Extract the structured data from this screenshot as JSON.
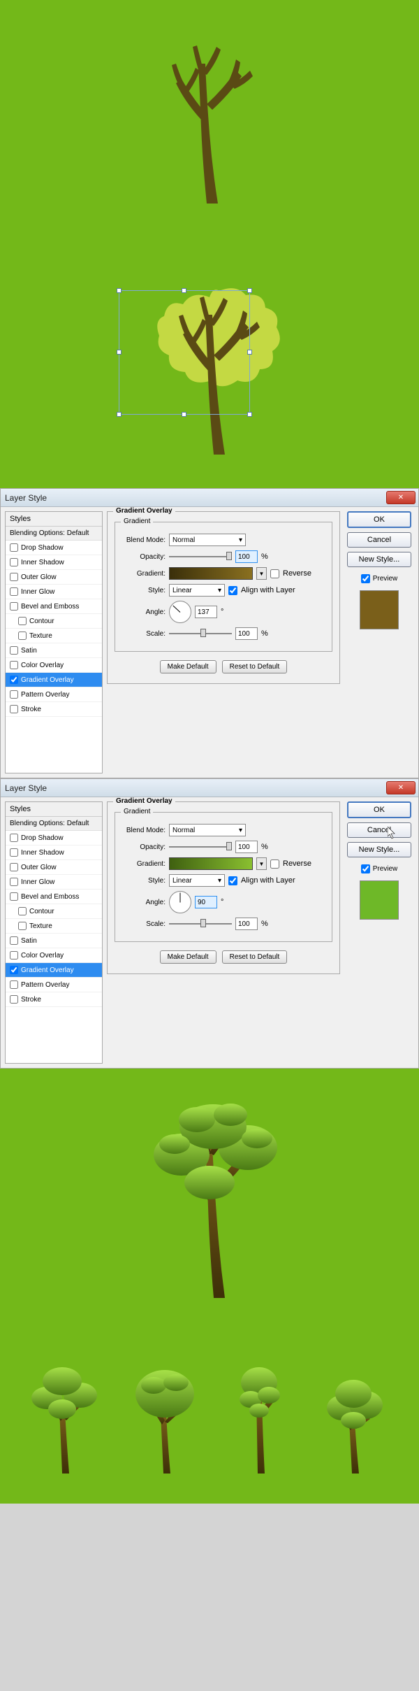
{
  "dialogs": [
    {
      "title": "Layer Style",
      "stylesHeader": "Styles",
      "blendingOptions": "Blending Options: Default",
      "styleItems": [
        {
          "label": "Drop Shadow",
          "checked": false,
          "indent": false,
          "selected": false
        },
        {
          "label": "Inner Shadow",
          "checked": false,
          "indent": false,
          "selected": false
        },
        {
          "label": "Outer Glow",
          "checked": false,
          "indent": false,
          "selected": false
        },
        {
          "label": "Inner Glow",
          "checked": false,
          "indent": false,
          "selected": false
        },
        {
          "label": "Bevel and Emboss",
          "checked": false,
          "indent": false,
          "selected": false
        },
        {
          "label": "Contour",
          "checked": false,
          "indent": true,
          "selected": false
        },
        {
          "label": "Texture",
          "checked": false,
          "indent": true,
          "selected": false
        },
        {
          "label": "Satin",
          "checked": false,
          "indent": false,
          "selected": false
        },
        {
          "label": "Color Overlay",
          "checked": false,
          "indent": false,
          "selected": false
        },
        {
          "label": "Gradient Overlay",
          "checked": true,
          "indent": false,
          "selected": true
        },
        {
          "label": "Pattern Overlay",
          "checked": false,
          "indent": false,
          "selected": false
        },
        {
          "label": "Stroke",
          "checked": false,
          "indent": false,
          "selected": false
        }
      ],
      "section": {
        "title": "Gradient Overlay",
        "group": "Gradient",
        "blendModeLabel": "Blend Mode:",
        "blendMode": "Normal",
        "opacityLabel": "Opacity:",
        "opacity": "100",
        "opacityHl": true,
        "gradientLabel": "Gradient:",
        "gradientClass": "grad-brown",
        "reverseLabel": "Reverse",
        "reverse": false,
        "styleLabel": "Style:",
        "style": "Linear",
        "alignLabel": "Align with Layer",
        "align": true,
        "angleLabel": "Angle:",
        "angle": "137",
        "angleDeg": 137,
        "angleHl": false,
        "degSymbol": "°",
        "scaleLabel": "Scale:",
        "scale": "100",
        "makeDefault": "Make Default",
        "resetDefault": "Reset to Default"
      },
      "buttons": {
        "ok": "OK",
        "cancel": "Cancel",
        "newStyle": "New Style...",
        "preview": "Preview"
      },
      "swatchClass": "swatch-brown",
      "pct": "%",
      "showCursor": false
    },
    {
      "title": "Layer Style",
      "stylesHeader": "Styles",
      "blendingOptions": "Blending Options: Default",
      "styleItems": [
        {
          "label": "Drop Shadow",
          "checked": false,
          "indent": false,
          "selected": false
        },
        {
          "label": "Inner Shadow",
          "checked": false,
          "indent": false,
          "selected": false
        },
        {
          "label": "Outer Glow",
          "checked": false,
          "indent": false,
          "selected": false
        },
        {
          "label": "Inner Glow",
          "checked": false,
          "indent": false,
          "selected": false
        },
        {
          "label": "Bevel and Emboss",
          "checked": false,
          "indent": false,
          "selected": false
        },
        {
          "label": "Contour",
          "checked": false,
          "indent": true,
          "selected": false
        },
        {
          "label": "Texture",
          "checked": false,
          "indent": true,
          "selected": false
        },
        {
          "label": "Satin",
          "checked": false,
          "indent": false,
          "selected": false
        },
        {
          "label": "Color Overlay",
          "checked": false,
          "indent": false,
          "selected": false
        },
        {
          "label": "Gradient Overlay",
          "checked": true,
          "indent": false,
          "selected": true
        },
        {
          "label": "Pattern Overlay",
          "checked": false,
          "indent": false,
          "selected": false
        },
        {
          "label": "Stroke",
          "checked": false,
          "indent": false,
          "selected": false
        }
      ],
      "section": {
        "title": "Gradient Overlay",
        "group": "Gradient",
        "blendModeLabel": "Blend Mode:",
        "blendMode": "Normal",
        "opacityLabel": "Opacity:",
        "opacity": "100",
        "opacityHl": false,
        "gradientLabel": "Gradient:",
        "gradientClass": "grad-green",
        "reverseLabel": "Reverse",
        "reverse": false,
        "styleLabel": "Style:",
        "style": "Linear",
        "alignLabel": "Align with Layer",
        "align": true,
        "angleLabel": "Angle:",
        "angle": "90",
        "angleDeg": 90,
        "angleHl": true,
        "degSymbol": "°",
        "scaleLabel": "Scale:",
        "scale": "100",
        "makeDefault": "Make Default",
        "resetDefault": "Reset to Default"
      },
      "buttons": {
        "ok": "OK",
        "cancel": "Cancel",
        "newStyle": "New Style...",
        "preview": "Preview"
      },
      "swatchClass": "swatch-green",
      "pct": "%",
      "showCursor": true
    }
  ]
}
